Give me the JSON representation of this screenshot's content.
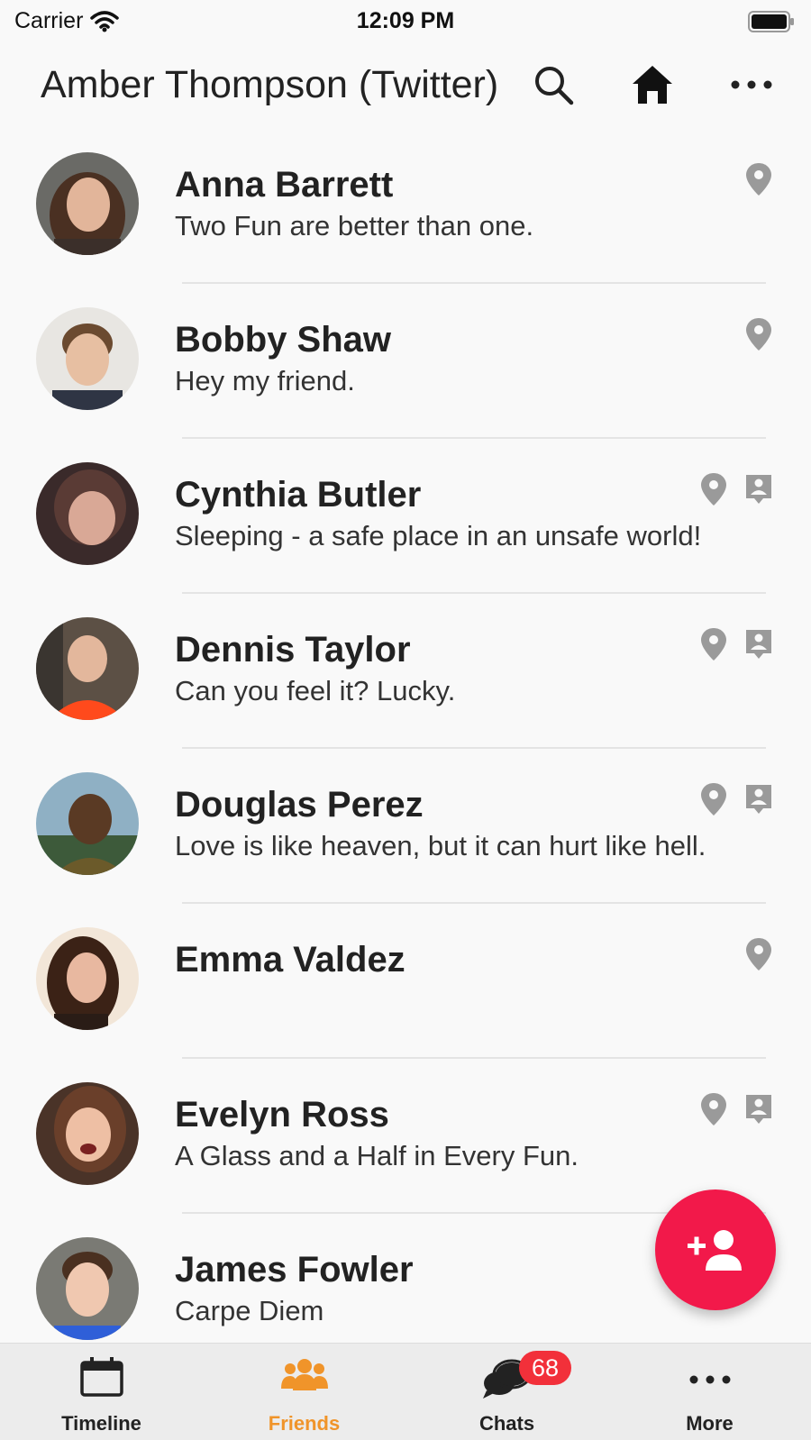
{
  "status_bar": {
    "carrier": "Carrier",
    "time": "12:09 PM"
  },
  "app_bar": {
    "title": "Amber Thompson (Twitter)"
  },
  "friends": [
    {
      "name": "Anna Barrett",
      "status": "Two Fun are better than one.",
      "has_location": true,
      "has_contact": false
    },
    {
      "name": "Bobby Shaw",
      "status": "Hey my friend.",
      "has_location": true,
      "has_contact": false
    },
    {
      "name": "Cynthia Butler",
      "status": "Sleeping - a safe place in an unsafe world!",
      "has_location": true,
      "has_contact": true
    },
    {
      "name": "Dennis Taylor",
      "status": "Can you feel it? Lucky.",
      "has_location": true,
      "has_contact": true
    },
    {
      "name": "Douglas Perez",
      "status": "Love is like heaven, but it can hurt like hell.",
      "has_location": true,
      "has_contact": true
    },
    {
      "name": "Emma Valdez",
      "status": "",
      "has_location": true,
      "has_contact": false
    },
    {
      "name": "Evelyn Ross",
      "status": "A Glass and a Half in Every Fun.",
      "has_location": true,
      "has_contact": true
    },
    {
      "name": "James Fowler",
      "status": "Carpe Diem",
      "has_location": false,
      "has_contact": false
    }
  ],
  "fab": {
    "icon": "add-friend-icon",
    "color": "#f2194a"
  },
  "tab_bar": {
    "tabs": [
      {
        "label": "Timeline",
        "icon": "calendar-icon"
      },
      {
        "label": "Friends",
        "icon": "people-icon",
        "active": true
      },
      {
        "label": "Chats",
        "icon": "chat-bubbles-icon",
        "badge": "68"
      },
      {
        "label": "More",
        "icon": "more-dots-icon"
      }
    ],
    "active_color": "#f0942a"
  }
}
